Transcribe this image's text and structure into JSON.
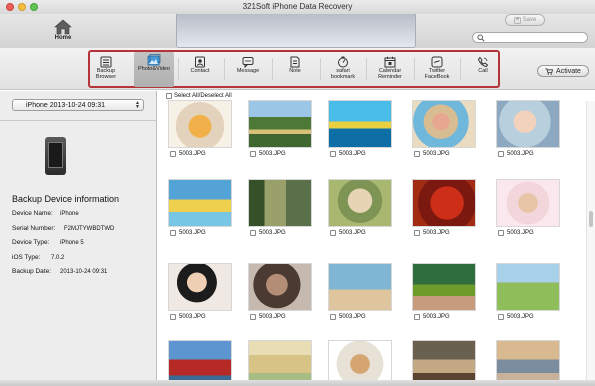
{
  "window": {
    "title": "321Soft iPhone Data Recovery"
  },
  "toolbar": {
    "home_label": "Home",
    "save_label": "Save",
    "search_placeholder": "",
    "activate_label": "Activate"
  },
  "categories": [
    {
      "label": "Backup\nBrowser",
      "icon": "backup-browser-icon",
      "active": false
    },
    {
      "label": "Photo&Video",
      "icon": "photo-video-icon",
      "active": true
    },
    {
      "label": "Contact",
      "icon": "contact-icon",
      "active": false
    },
    {
      "label": "Message",
      "icon": "message-icon",
      "active": false
    },
    {
      "label": "Note",
      "icon": "note-icon",
      "active": false
    },
    {
      "label": "safari\nbookmark",
      "icon": "safari-bookmark-icon",
      "active": false
    },
    {
      "label": "Calendar\nReminder",
      "icon": "calendar-icon",
      "active": false
    },
    {
      "label": "Twitter\nFaceBook",
      "icon": "twitter-facebook-icon",
      "active": false
    },
    {
      "label": "Call",
      "icon": "call-icon",
      "active": false
    }
  ],
  "sidebar": {
    "device_select": "iPhone 2013-10-24 09:31",
    "info_title": "Backup Device information",
    "info": [
      {
        "key": "Device Name:",
        "value": "iPhone"
      },
      {
        "key": "Serial Number:",
        "value": "F2MJTYWBDTWD"
      },
      {
        "key": "Device Type:",
        "value": "iPhone 5"
      },
      {
        "key": "iOS Type:",
        "value": "7.0.2"
      },
      {
        "key": "Backup Date:",
        "value": "2013-10-24 09:31"
      }
    ]
  },
  "main": {
    "select_all_label": "Select All/Deselect All",
    "photos": [
      {
        "name": "5003.JPG",
        "color": "p-orange"
      },
      {
        "name": "5003.JPG",
        "color": "p-forest"
      },
      {
        "name": "5003.JPG",
        "color": "p-kid-sea"
      },
      {
        "name": "5003.JPG",
        "color": "p-beach-kid"
      },
      {
        "name": "5003.JPG",
        "color": "p-baby-cup"
      },
      {
        "name": "5003.JPG",
        "color": "p-kid-float"
      },
      {
        "name": "5003.JPG",
        "color": "p-cam"
      },
      {
        "name": "5003.JPG",
        "color": "p-oldman"
      },
      {
        "name": "5003.JPG",
        "color": "p-red"
      },
      {
        "name": "5003.JPG",
        "color": "p-girls"
      },
      {
        "name": "5003.JPG",
        "color": "p-woman"
      },
      {
        "name": "5003.JPG",
        "color": "p-kiss"
      },
      {
        "name": "5003.JPG",
        "color": "p-beach-people"
      },
      {
        "name": "5003.JPG",
        "color": "p-picnic"
      },
      {
        "name": "5003.JPG",
        "color": "p-grass-girl"
      },
      {
        "name": "",
        "color": "p-ship"
      },
      {
        "name": "",
        "color": "p-menu"
      },
      {
        "name": "",
        "color": "p-food"
      },
      {
        "name": "",
        "color": "p-street"
      },
      {
        "name": "",
        "color": "p-sunset"
      }
    ]
  },
  "colors": {
    "highlight_border": "#b5343a",
    "active_category_bg": "#b8b8b8"
  }
}
